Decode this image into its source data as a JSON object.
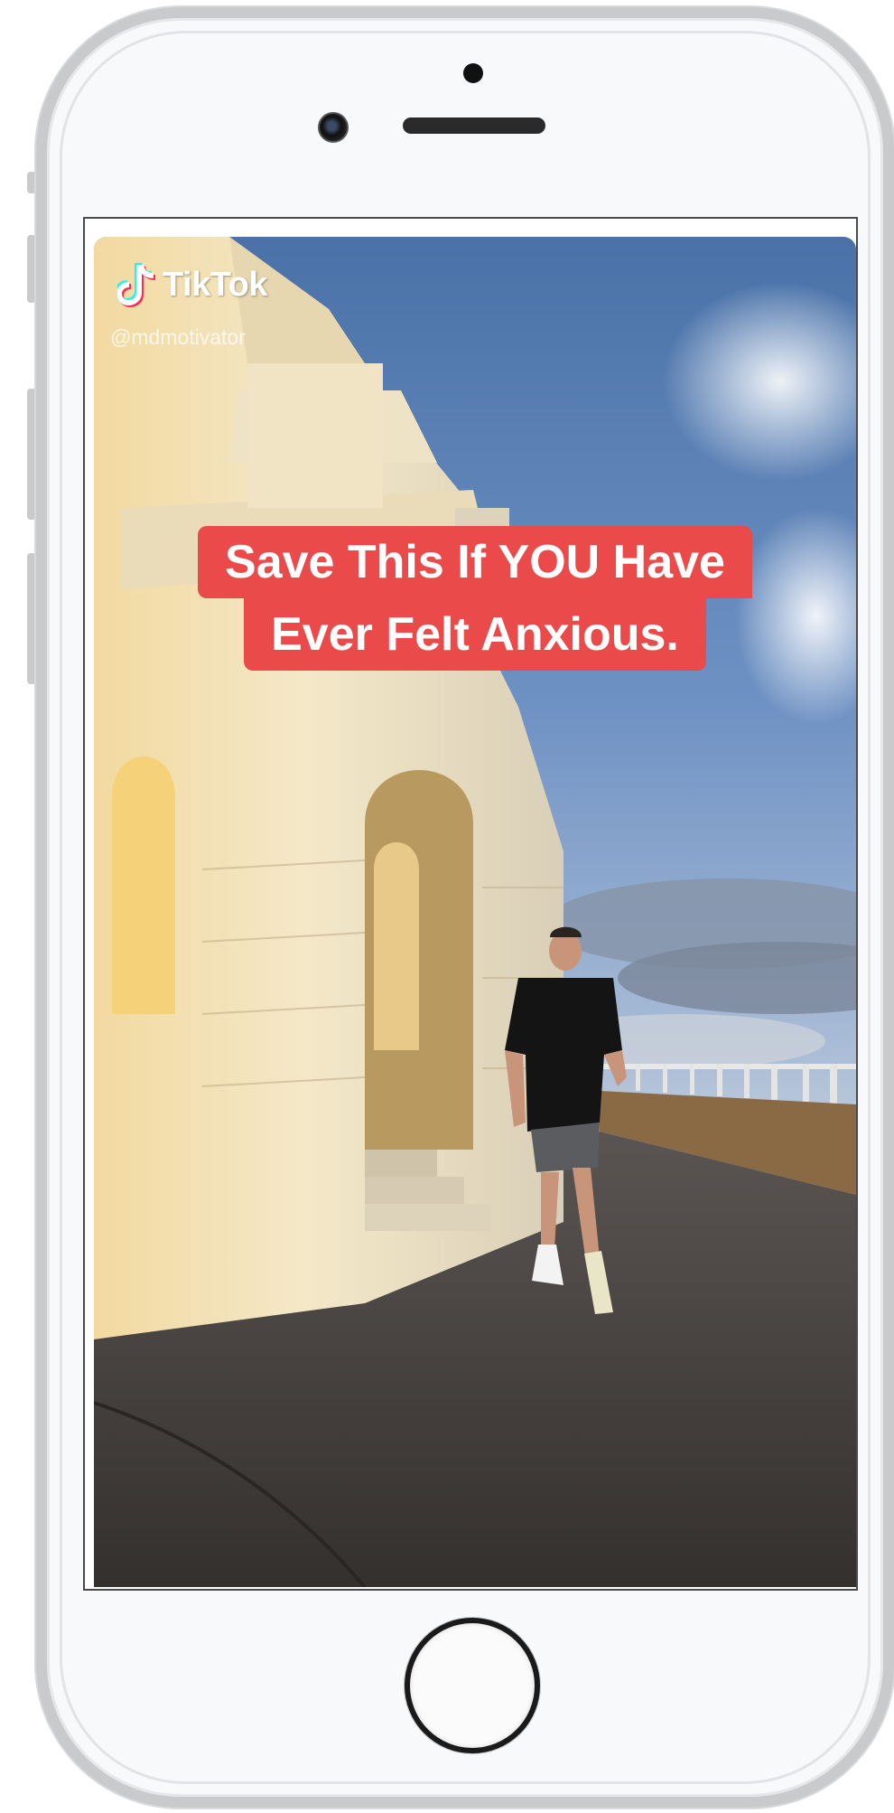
{
  "video": {
    "brand": "TikTok",
    "handle": "@mdmotivator",
    "caption_line_1": "Save This If YOU Have",
    "caption_line_2": "Ever Felt Anxious."
  },
  "icons": {
    "tiktok_logo": "tiktok-note-icon",
    "home": "home-button"
  },
  "colors": {
    "caption_bg": "#ea4a4a",
    "caption_text": "#ffffff",
    "phone_frame": "#c9cacc",
    "phone_face": "#f8f9fb"
  }
}
